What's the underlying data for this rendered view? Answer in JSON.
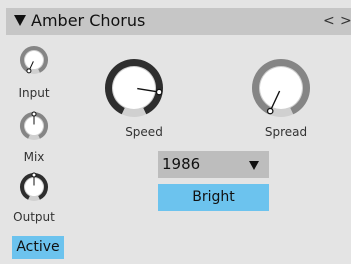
{
  "device": {
    "title": "Amber Chorus",
    "nav_prev": "<",
    "nav_next": ">"
  },
  "knobs": {
    "input": {
      "label": "Input",
      "value_fraction": 0.0
    },
    "mix": {
      "label": "Mix",
      "value_fraction": 0.5
    },
    "output": {
      "label": "Output",
      "value_fraction": 0.5
    },
    "speed": {
      "label": "Speed",
      "value_fraction": 0.82
    },
    "spread": {
      "label": "Spread",
      "value_fraction": 0.0
    }
  },
  "preset": {
    "selected": "1986"
  },
  "bright_button": {
    "label": "Bright"
  },
  "active_button": {
    "label": "Active"
  },
  "icons": {
    "collapse": "triangle-down-icon",
    "dropdown": "triangle-down-icon"
  },
  "colors": {
    "accent": "#6cc3ee",
    "titlebar": "#c6c6c6",
    "panel": "#e4e4e4",
    "knob_dark": "#2e2e2e",
    "knob_grey": "#858585"
  }
}
